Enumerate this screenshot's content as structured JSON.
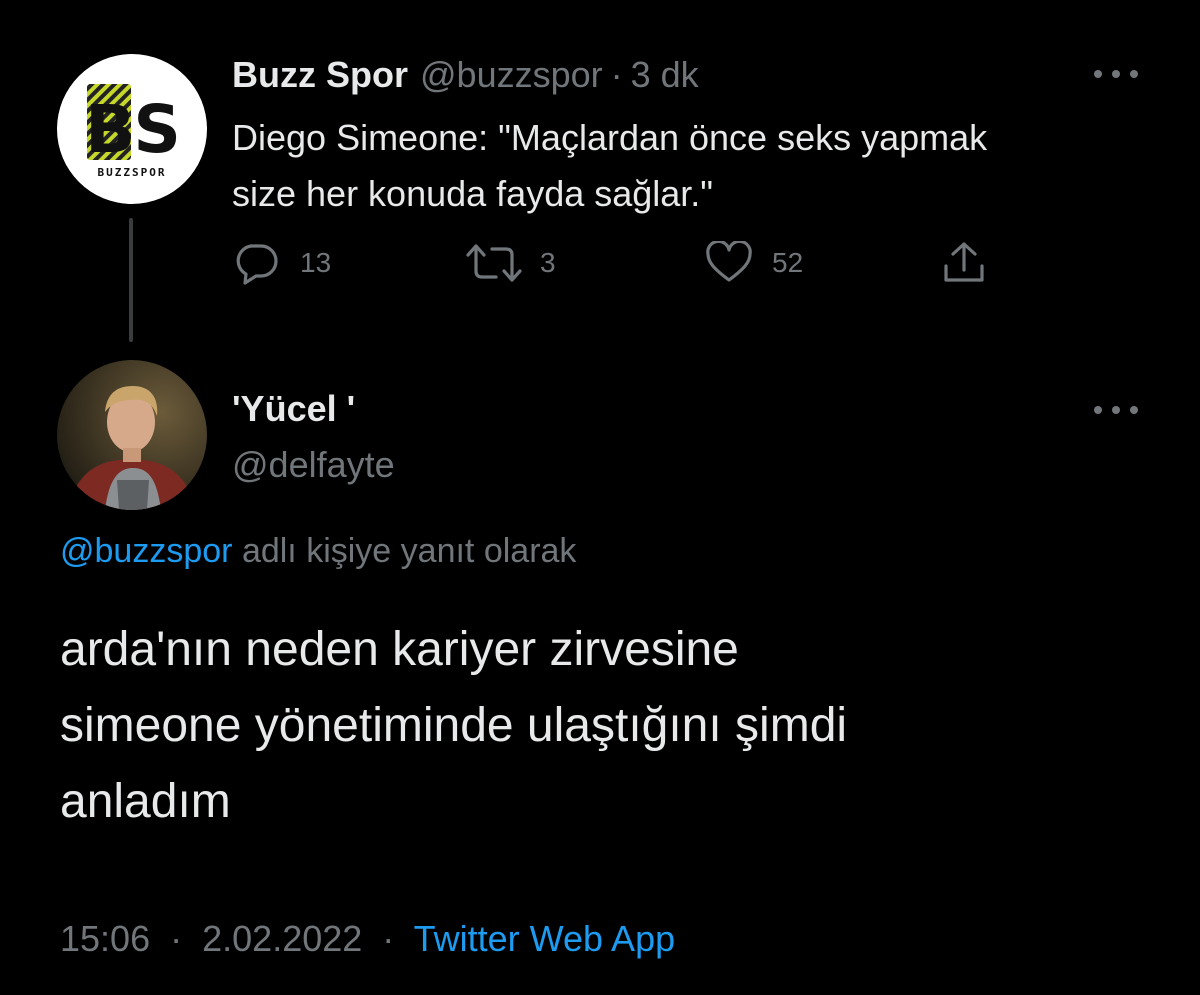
{
  "parent_tweet": {
    "avatar_text": "BS",
    "avatar_caption": "BUZZSPOR",
    "name": "Buzz Spor",
    "handle": "@buzzspor",
    "separator": "·",
    "time": "3 dk",
    "text_lines": [
      "Diego Simeone: \"Maçlardan önce seks yapmak",
      "size her konuda fayda sağlar.\""
    ],
    "actions": {
      "reply": {
        "icon": "reply-icon",
        "count": "13"
      },
      "retweet": {
        "icon": "retweet-icon",
        "count": "3"
      },
      "like": {
        "icon": "heart-icon",
        "count": "52"
      },
      "share": {
        "icon": "share-icon"
      }
    },
    "more_icon": "more-horizontal-icon"
  },
  "reply_tweet": {
    "name": "'Yücel '",
    "handle": "@delfayte",
    "more_icon": "more-horizontal-icon",
    "reply_to": {
      "mention": "@buzzspor",
      "text": "adlı kişiye yanıt olarak"
    },
    "text_lines": [
      "arda'nın neden kariyer zirvesine",
      "simeone yönetiminde ulaştığını şimdi",
      "anladım"
    ],
    "timestamp_time": "15:06",
    "separator": "·",
    "timestamp_date": "2.02.2022",
    "source": "Twitter Web App"
  },
  "colors": {
    "background": "#000000",
    "text_primary": "#e7e9ea",
    "text_secondary": "#71767b",
    "link": "#1d9bf0",
    "brand_lime": "#c6d92a"
  }
}
